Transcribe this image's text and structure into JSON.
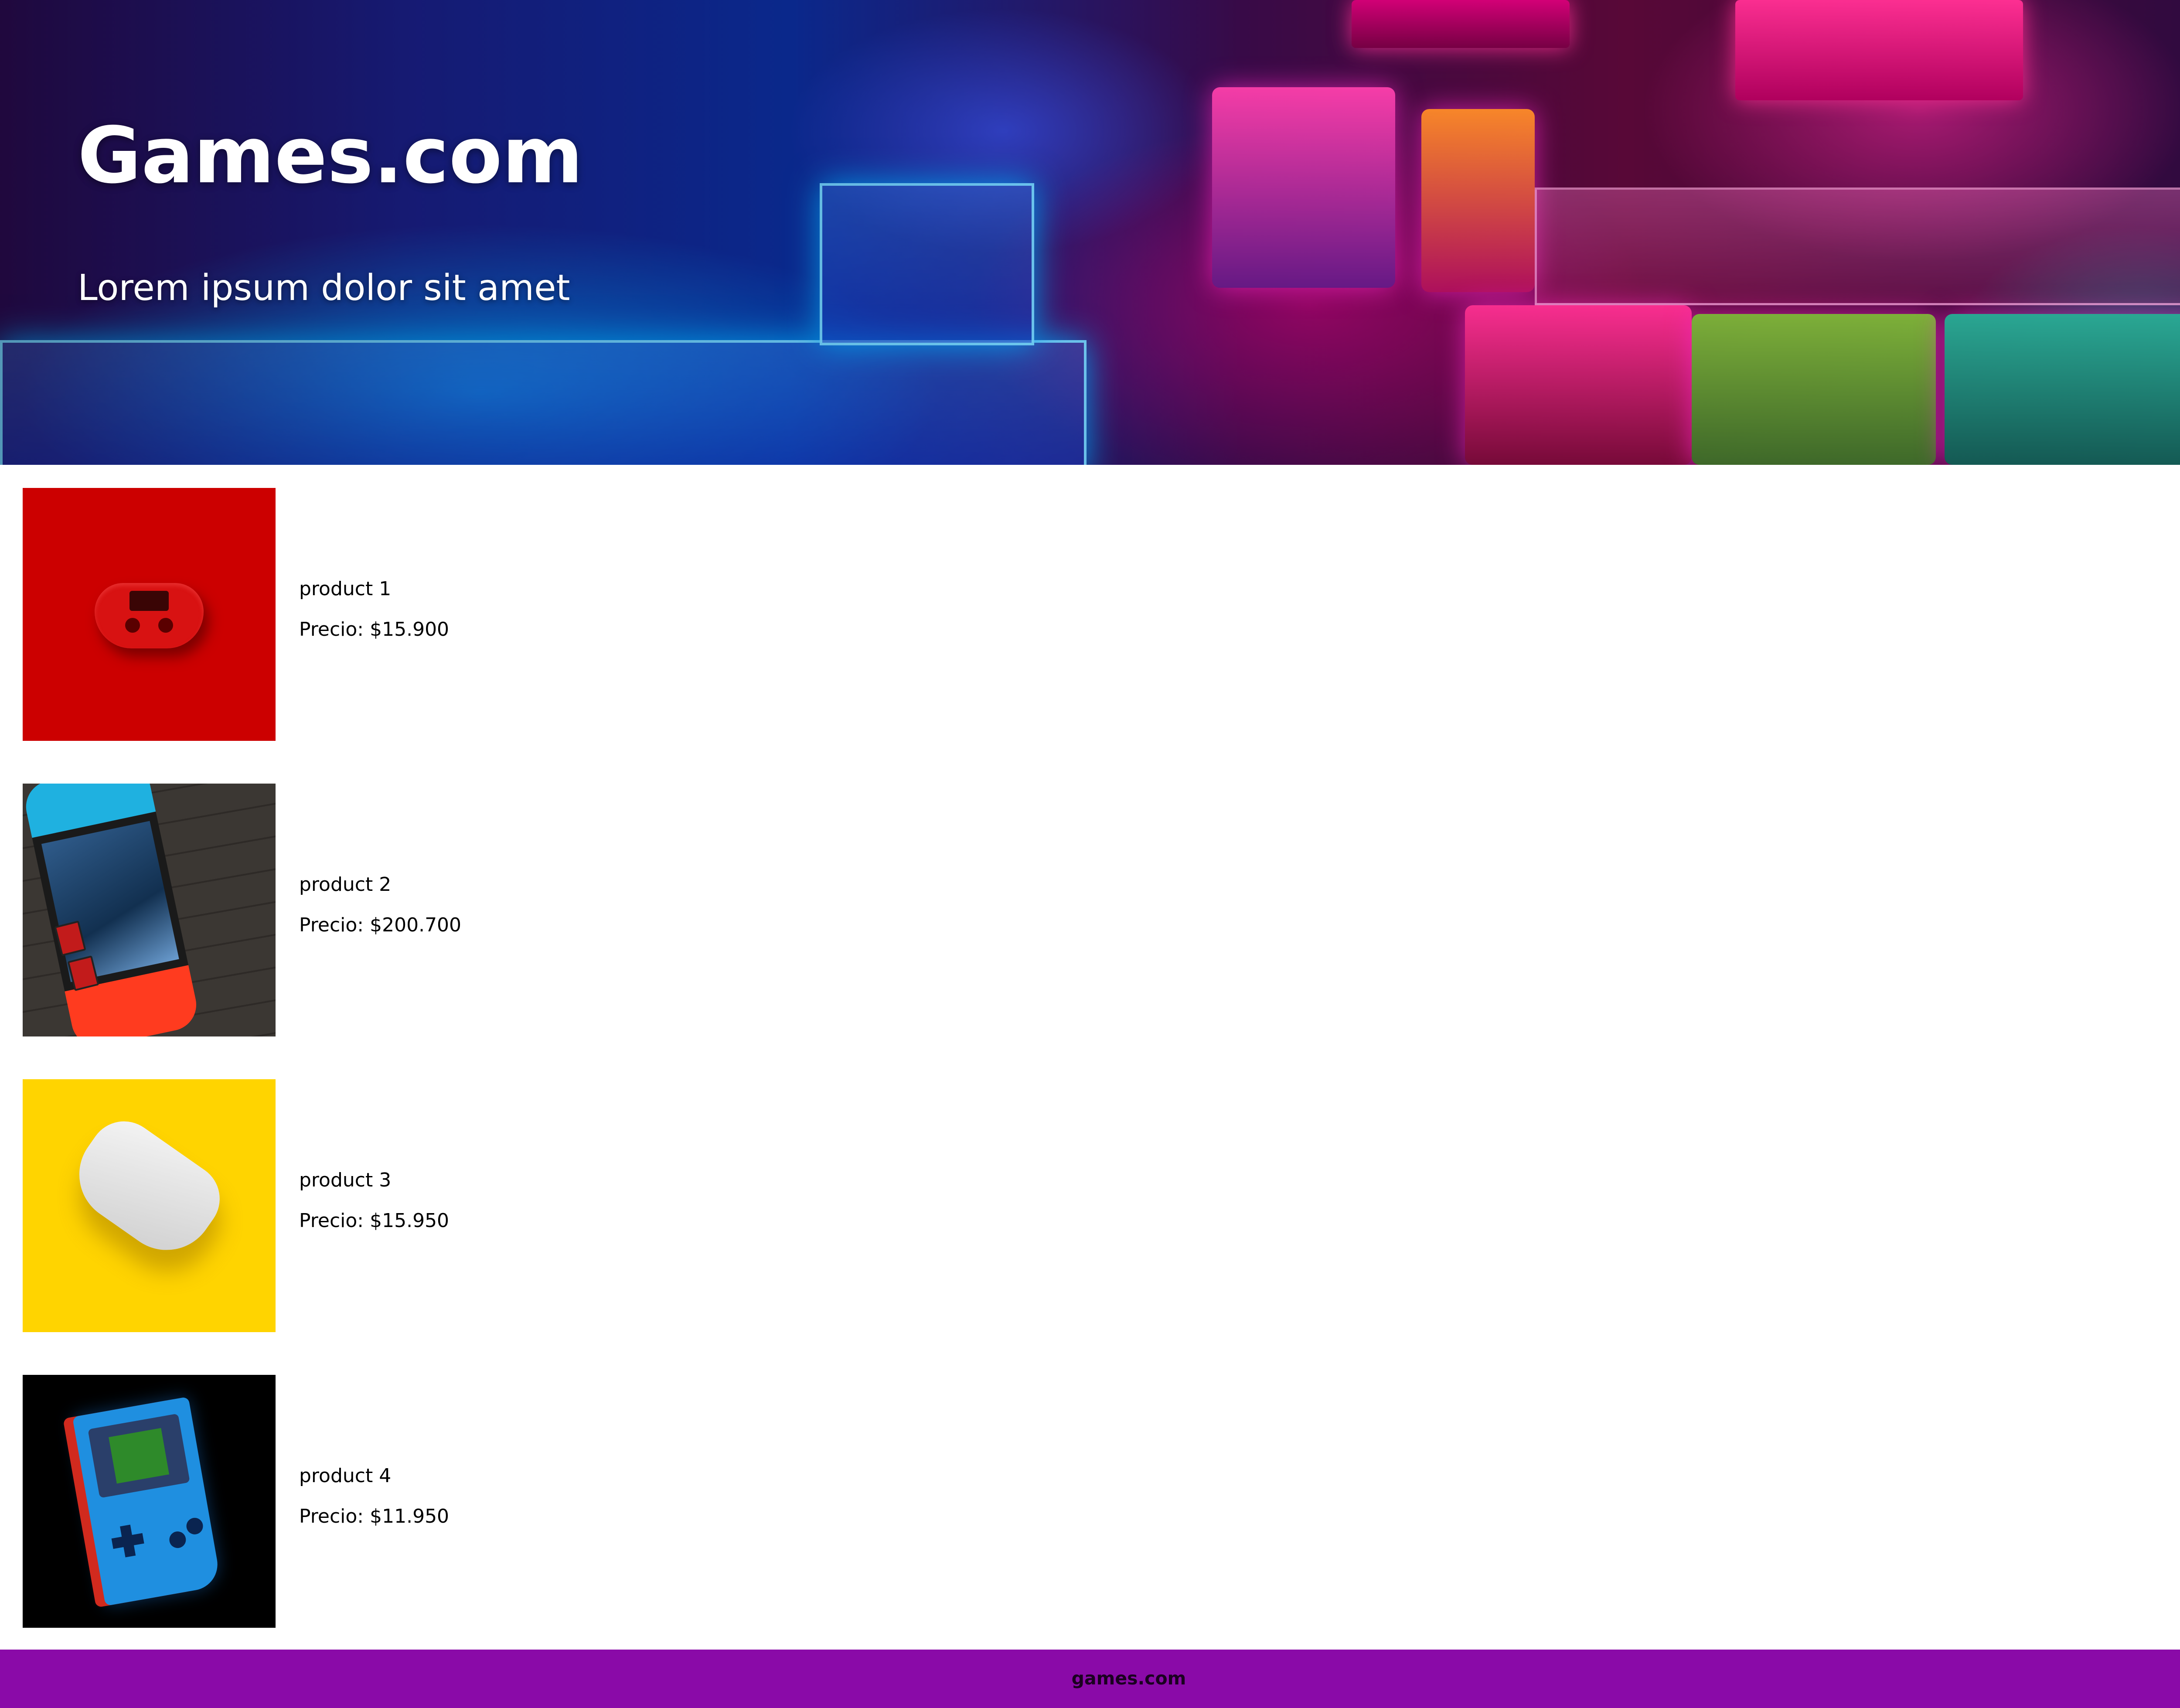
{
  "hero": {
    "title": "Games.com",
    "subtitle": "Lorem ipsum dolor sit amet",
    "image": "arcade-photo"
  },
  "products": [
    {
      "name": "product 1",
      "price": "Precio: $15.900",
      "image": "red-gamepad-photo"
    },
    {
      "name": "product 2",
      "price": "Precio: $200.700",
      "image": "handheld-console-photo"
    },
    {
      "name": "product 3",
      "price": "Precio: $15.950",
      "image": "white-gamepad-photo"
    },
    {
      "name": "product 4",
      "price": "Precio: $11.950",
      "image": "blue-gameboy-photo"
    }
  ],
  "footer": {
    "text": "games.com",
    "background_color": "#8a0aa8"
  }
}
